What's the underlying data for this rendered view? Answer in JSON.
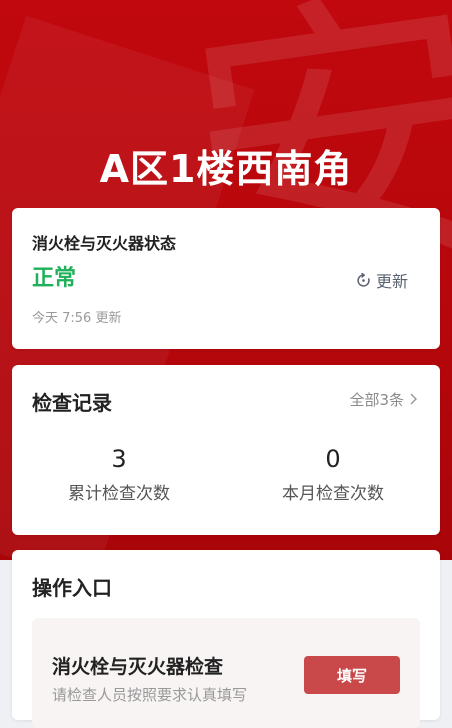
{
  "hero": {
    "title": "A区1楼西南角",
    "background_char": "安"
  },
  "status_card": {
    "title": "消火栓与灭火器状态",
    "status": "正常",
    "status_color": "#1fb05a",
    "updated_text": "今天 7:56 更新",
    "refresh_label": "更新",
    "refresh_icon": "refresh-icon"
  },
  "records_card": {
    "title": "检查记录",
    "all_link": "全部3条",
    "all_icon": "chevron-right-icon",
    "stats": [
      {
        "value": "3",
        "label": "累计检查次数"
      },
      {
        "value": "0",
        "label": "本月检查次数"
      }
    ]
  },
  "ops_card": {
    "title": "操作入口",
    "items": [
      {
        "name": "消火栓与灭火器检查",
        "desc": "请检查人员按照要求认真填写",
        "button": "填写"
      }
    ]
  },
  "colors": {
    "brand_red": "#c0080e",
    "button_red": "#c9484a"
  }
}
